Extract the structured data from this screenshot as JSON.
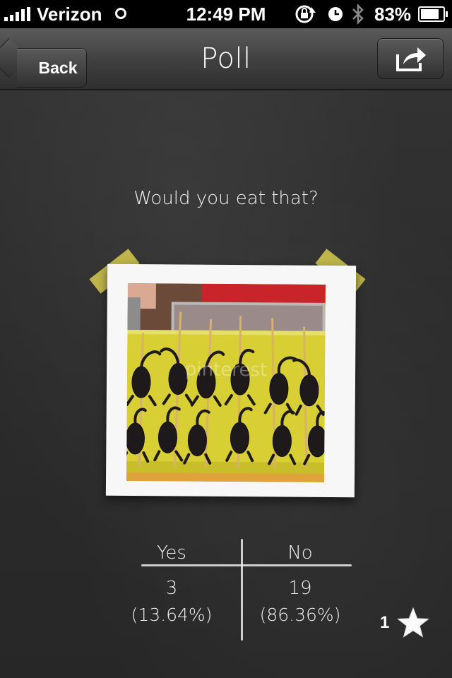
{
  "status_bar": {
    "carrier": "Verizon",
    "time": "12:49 PM",
    "battery_percent": "83%",
    "battery_level": 0.83
  },
  "nav": {
    "back_label": "Back",
    "title": "Poll"
  },
  "poll": {
    "question": "Would you eat that?",
    "options": [
      {
        "label": "Yes",
        "count": "3",
        "percent": "(13.64%)"
      },
      {
        "label": "No",
        "count": "19",
        "percent": "(86.36%)"
      }
    ],
    "favorites": "1"
  },
  "colors": {
    "chalkboard": "#2b2b2b",
    "tape": "#ded250",
    "tray": "#d8d03a"
  }
}
